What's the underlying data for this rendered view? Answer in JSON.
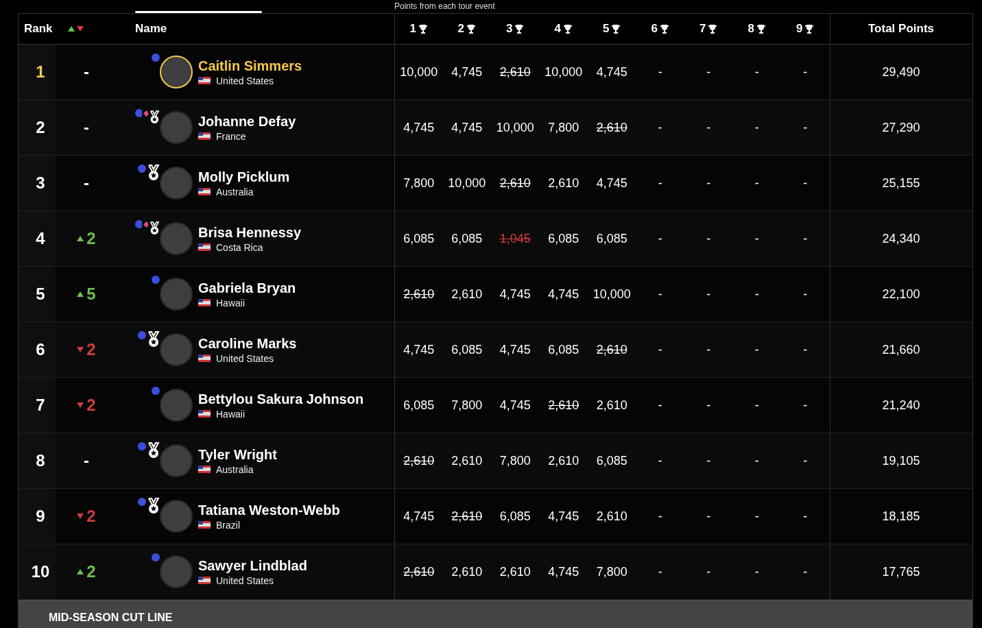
{
  "caption": "Points from each tour event",
  "columns": {
    "rank": "Rank",
    "name": "Name",
    "events": [
      "1",
      "2",
      "3",
      "4",
      "5",
      "6",
      "7",
      "8",
      "9"
    ],
    "total": "Total Points"
  },
  "rows": [
    {
      "rank": "1",
      "move": {
        "rising": false,
        "falling": false,
        "text": "-"
      },
      "leader": true,
      "dot": true,
      "diamond": false,
      "medal": false,
      "name": "Caitlin Simmers",
      "country": "United States",
      "scores": [
        {
          "v": "10,000",
          "dropped": false,
          "penalty": false
        },
        {
          "v": "4,745",
          "dropped": false,
          "penalty": false
        },
        {
          "v": "2,610",
          "dropped": true,
          "penalty": false
        },
        {
          "v": "10,000",
          "dropped": false,
          "penalty": false
        },
        {
          "v": "4,745",
          "dropped": false,
          "penalty": false
        },
        {
          "v": "-",
          "dropped": false,
          "penalty": false
        },
        {
          "v": "-",
          "dropped": false,
          "penalty": false
        },
        {
          "v": "-",
          "dropped": false,
          "penalty": false
        },
        {
          "v": "-",
          "dropped": false,
          "penalty": false
        }
      ],
      "total": "29,490"
    },
    {
      "rank": "2",
      "move": {
        "rising": false,
        "falling": false,
        "text": "-"
      },
      "leader": false,
      "dot": true,
      "diamond": true,
      "medal": true,
      "name": "Johanne Defay",
      "country": "France",
      "scores": [
        {
          "v": "4,745",
          "dropped": false,
          "penalty": false
        },
        {
          "v": "4,745",
          "dropped": false,
          "penalty": false
        },
        {
          "v": "10,000",
          "dropped": false,
          "penalty": false
        },
        {
          "v": "7,800",
          "dropped": false,
          "penalty": false
        },
        {
          "v": "2,610",
          "dropped": true,
          "penalty": false
        },
        {
          "v": "-",
          "dropped": false,
          "penalty": false
        },
        {
          "v": "-",
          "dropped": false,
          "penalty": false
        },
        {
          "v": "-",
          "dropped": false,
          "penalty": false
        },
        {
          "v": "-",
          "dropped": false,
          "penalty": false
        }
      ],
      "total": "27,290"
    },
    {
      "rank": "3",
      "move": {
        "rising": false,
        "falling": false,
        "text": "-"
      },
      "leader": false,
      "dot": true,
      "diamond": false,
      "medal": true,
      "name": "Molly Picklum",
      "country": "Australia",
      "scores": [
        {
          "v": "7,800",
          "dropped": false,
          "penalty": false
        },
        {
          "v": "10,000",
          "dropped": false,
          "penalty": false
        },
        {
          "v": "2,610",
          "dropped": true,
          "penalty": false
        },
        {
          "v": "2,610",
          "dropped": false,
          "penalty": false
        },
        {
          "v": "4,745",
          "dropped": false,
          "penalty": false
        },
        {
          "v": "-",
          "dropped": false,
          "penalty": false
        },
        {
          "v": "-",
          "dropped": false,
          "penalty": false
        },
        {
          "v": "-",
          "dropped": false,
          "penalty": false
        },
        {
          "v": "-",
          "dropped": false,
          "penalty": false
        }
      ],
      "total": "25,155"
    },
    {
      "rank": "4",
      "move": {
        "rising": true,
        "falling": false,
        "text": "2"
      },
      "leader": false,
      "dot": true,
      "diamond": true,
      "medal": true,
      "name": "Brisa Hennessy",
      "country": "Costa Rica",
      "scores": [
        {
          "v": "6,085",
          "dropped": false,
          "penalty": false
        },
        {
          "v": "6,085",
          "dropped": false,
          "penalty": false
        },
        {
          "v": "1,045",
          "dropped": true,
          "penalty": true
        },
        {
          "v": "6,085",
          "dropped": false,
          "penalty": false
        },
        {
          "v": "6,085",
          "dropped": false,
          "penalty": false
        },
        {
          "v": "-",
          "dropped": false,
          "penalty": false
        },
        {
          "v": "-",
          "dropped": false,
          "penalty": false
        },
        {
          "v": "-",
          "dropped": false,
          "penalty": false
        },
        {
          "v": "-",
          "dropped": false,
          "penalty": false
        }
      ],
      "total": "24,340"
    },
    {
      "rank": "5",
      "move": {
        "rising": true,
        "falling": false,
        "text": "5"
      },
      "leader": false,
      "dot": true,
      "diamond": false,
      "medal": false,
      "name": "Gabriela Bryan",
      "country": "Hawaii",
      "scores": [
        {
          "v": "2,610",
          "dropped": true,
          "penalty": false
        },
        {
          "v": "2,610",
          "dropped": false,
          "penalty": false
        },
        {
          "v": "4,745",
          "dropped": false,
          "penalty": false
        },
        {
          "v": "4,745",
          "dropped": false,
          "penalty": false
        },
        {
          "v": "10,000",
          "dropped": false,
          "penalty": false
        },
        {
          "v": "-",
          "dropped": false,
          "penalty": false
        },
        {
          "v": "-",
          "dropped": false,
          "penalty": false
        },
        {
          "v": "-",
          "dropped": false,
          "penalty": false
        },
        {
          "v": "-",
          "dropped": false,
          "penalty": false
        }
      ],
      "total": "22,100"
    },
    {
      "rank": "6",
      "move": {
        "rising": false,
        "falling": true,
        "text": "2"
      },
      "leader": false,
      "dot": true,
      "diamond": false,
      "medal": true,
      "name": "Caroline Marks",
      "country": "United States",
      "scores": [
        {
          "v": "4,745",
          "dropped": false,
          "penalty": false
        },
        {
          "v": "6,085",
          "dropped": false,
          "penalty": false
        },
        {
          "v": "4,745",
          "dropped": false,
          "penalty": false
        },
        {
          "v": "6,085",
          "dropped": false,
          "penalty": false
        },
        {
          "v": "2,610",
          "dropped": true,
          "penalty": false
        },
        {
          "v": "-",
          "dropped": false,
          "penalty": false
        },
        {
          "v": "-",
          "dropped": false,
          "penalty": false
        },
        {
          "v": "-",
          "dropped": false,
          "penalty": false
        },
        {
          "v": "-",
          "dropped": false,
          "penalty": false
        }
      ],
      "total": "21,660"
    },
    {
      "rank": "7",
      "move": {
        "rising": false,
        "falling": true,
        "text": "2"
      },
      "leader": false,
      "dot": true,
      "diamond": false,
      "medal": false,
      "name": "Bettylou Sakura Johnson",
      "country": "Hawaii",
      "scores": [
        {
          "v": "6,085",
          "dropped": false,
          "penalty": false
        },
        {
          "v": "7,800",
          "dropped": false,
          "penalty": false
        },
        {
          "v": "4,745",
          "dropped": false,
          "penalty": false
        },
        {
          "v": "2,610",
          "dropped": true,
          "penalty": false
        },
        {
          "v": "2,610",
          "dropped": false,
          "penalty": false
        },
        {
          "v": "-",
          "dropped": false,
          "penalty": false
        },
        {
          "v": "-",
          "dropped": false,
          "penalty": false
        },
        {
          "v": "-",
          "dropped": false,
          "penalty": false
        },
        {
          "v": "-",
          "dropped": false,
          "penalty": false
        }
      ],
      "total": "21,240"
    },
    {
      "rank": "8",
      "move": {
        "rising": false,
        "falling": false,
        "text": "-"
      },
      "leader": false,
      "dot": true,
      "diamond": false,
      "medal": true,
      "name": "Tyler Wright",
      "country": "Australia",
      "scores": [
        {
          "v": "2,610",
          "dropped": true,
          "penalty": false
        },
        {
          "v": "2,610",
          "dropped": false,
          "penalty": false
        },
        {
          "v": "7,800",
          "dropped": false,
          "penalty": false
        },
        {
          "v": "2,610",
          "dropped": false,
          "penalty": false
        },
        {
          "v": "6,085",
          "dropped": false,
          "penalty": false
        },
        {
          "v": "-",
          "dropped": false,
          "penalty": false
        },
        {
          "v": "-",
          "dropped": false,
          "penalty": false
        },
        {
          "v": "-",
          "dropped": false,
          "penalty": false
        },
        {
          "v": "-",
          "dropped": false,
          "penalty": false
        }
      ],
      "total": "19,105"
    },
    {
      "rank": "9",
      "move": {
        "rising": false,
        "falling": true,
        "text": "2"
      },
      "leader": false,
      "dot": true,
      "diamond": false,
      "medal": true,
      "name": "Tatiana Weston-Webb",
      "country": "Brazil",
      "scores": [
        {
          "v": "4,745",
          "dropped": false,
          "penalty": false
        },
        {
          "v": "2,610",
          "dropped": true,
          "penalty": false
        },
        {
          "v": "6,085",
          "dropped": false,
          "penalty": false
        },
        {
          "v": "4,745",
          "dropped": false,
          "penalty": false
        },
        {
          "v": "2,610",
          "dropped": false,
          "penalty": false
        },
        {
          "v": "-",
          "dropped": false,
          "penalty": false
        },
        {
          "v": "-",
          "dropped": false,
          "penalty": false
        },
        {
          "v": "-",
          "dropped": false,
          "penalty": false
        },
        {
          "v": "-",
          "dropped": false,
          "penalty": false
        }
      ],
      "total": "18,185"
    },
    {
      "rank": "10",
      "move": {
        "rising": true,
        "falling": false,
        "text": "2"
      },
      "leader": false,
      "dot": true,
      "diamond": false,
      "medal": false,
      "name": "Sawyer Lindblad",
      "country": "United States",
      "scores": [
        {
          "v": "2,610",
          "dropped": true,
          "penalty": false
        },
        {
          "v": "2,610",
          "dropped": false,
          "penalty": false
        },
        {
          "v": "2,610",
          "dropped": false,
          "penalty": false
        },
        {
          "v": "4,745",
          "dropped": false,
          "penalty": false
        },
        {
          "v": "7,800",
          "dropped": false,
          "penalty": false
        },
        {
          "v": "-",
          "dropped": false,
          "penalty": false
        },
        {
          "v": "-",
          "dropped": false,
          "penalty": false
        },
        {
          "v": "-",
          "dropped": false,
          "penalty": false
        },
        {
          "v": "-",
          "dropped": false,
          "penalty": false
        }
      ],
      "total": "17,765"
    }
  ],
  "cut_line": "MID-SEASON CUT LINE"
}
